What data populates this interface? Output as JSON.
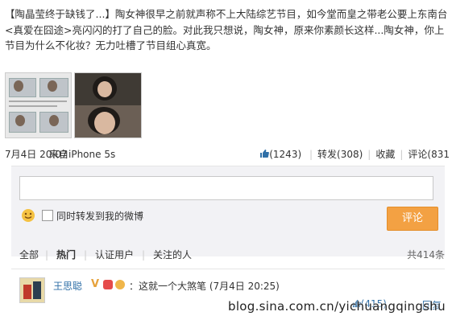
{
  "post": {
    "title": "【陶晶莹终于缺钱了...】",
    "body": "陶女神很早之前就声称不上大陆综艺节目，如今堂而皇之带老公要上东南台<真爱在囧途>亮闪闪的打了自己的脸。对此我只想说，陶女神，原来你素颜长这样...陶女神，你上节目为什么不化妆？无力吐槽了节目组心真宽。",
    "time": "7月4日 20:07",
    "source": "来自iPhone 5s"
  },
  "actions": {
    "like": "(1243)",
    "repost": "转发(308)",
    "favorite": "收藏",
    "comment": "评论(831"
  },
  "comment_form": {
    "input_value": "",
    "repost_label": "同时转发到我的微博",
    "submit_label": "评论"
  },
  "filters": {
    "all": "全部",
    "hot": "热门",
    "verified": "认证用户",
    "following": "关注的人",
    "count": "共414条"
  },
  "comment": {
    "user": "王思聪",
    "v_badge": "V",
    "text": "：这就一个大煞笔 (7月4日 20:25)",
    "likes": "(415)",
    "reply": "回复"
  },
  "watermark": "blog.sina.com.cn/yichuangqingshu",
  "colors": {
    "link": "#2f6fa7",
    "submit_button": "#f3a143",
    "form_background": "#f2f2f5"
  }
}
